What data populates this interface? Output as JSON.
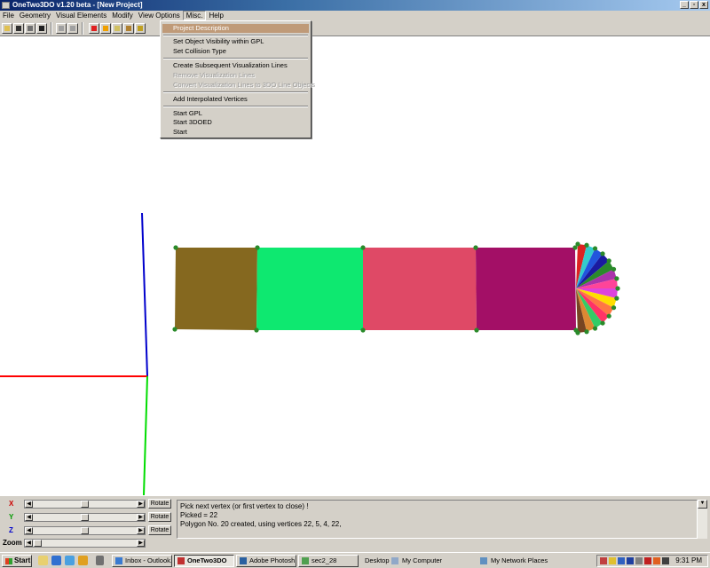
{
  "window": {
    "title": "OneTwo3DO v1.20 beta - [New Project]",
    "controls": {
      "minimize": "_",
      "restore": "▫",
      "close": "x"
    }
  },
  "menubar": [
    "File",
    "Geometry",
    "Visual Elements",
    "Modify",
    "View Options",
    "Misc.",
    "Help"
  ],
  "misc_menu": {
    "groups": [
      [
        {
          "label": "Project Description",
          "enabled": true,
          "highlighted": true
        }
      ],
      [
        {
          "label": "Set Object Visibility within GPL",
          "enabled": true
        },
        {
          "label": "Set Collision Type",
          "enabled": true
        }
      ],
      [
        {
          "label": "Create Subsequent Visualization Lines",
          "enabled": true
        },
        {
          "label": "Remove Visualization Lines",
          "enabled": false
        },
        {
          "label": "Convert Visualization Lines to 3DO Line Objects",
          "enabled": false
        }
      ],
      [
        {
          "label": "Add Interpolated Vertices",
          "enabled": true
        }
      ],
      [
        {
          "label": "Start GPL",
          "enabled": true
        },
        {
          "label": "Start 3DOED",
          "enabled": true
        },
        {
          "label": "Start",
          "enabled": true
        }
      ]
    ]
  },
  "toolbar": {
    "icons": [
      "open-icon",
      "save-icon",
      "copy-icon",
      "disk-icon",
      "undo-icon",
      "redo-icon",
      "vertex-icon",
      "line-icon",
      "polygon-icon",
      "object-icon",
      "texture-icon"
    ]
  },
  "viewport": {
    "axis_colors": {
      "x": "#ff0000",
      "y": "#00dd00",
      "z": "#0000cc"
    },
    "vertex_color": "#2a8a2a",
    "rect_colors": [
      "#85681f",
      "#0ee870",
      "#df4966",
      "#a30f66"
    ],
    "fan_colors": [
      "#dd2222",
      "#33cccc",
      "#2255dd",
      "#1a1aa0",
      "#2a8a2a",
      "#aa33aa",
      "#ff4499",
      "#dd44dd",
      "#ffdd00",
      "#ff7744",
      "#ff3366",
      "#33cc66",
      "#dd8833",
      "#774422"
    ]
  },
  "controls": {
    "sliders": [
      {
        "label": "X",
        "button": "Rotate",
        "color": "#cc0000"
      },
      {
        "label": "Y",
        "button": "Rotate",
        "color": "#009900"
      },
      {
        "label": "Z",
        "button": "Rotate",
        "color": "#0000cc"
      },
      {
        "label": "Zoom",
        "button": "",
        "color": "#000000"
      }
    ]
  },
  "console": {
    "lines": [
      "Pick next vertex (or first vertex to close) !",
      "Picked = 22",
      "Polygon No. 20 created, using vertices 22, 5, 4, 22,"
    ]
  },
  "taskbar": {
    "start": "Start",
    "tasks": [
      {
        "label": "Inbox - Outlook...",
        "active": false
      },
      {
        "label": "OneTwo3DO",
        "active": true
      },
      {
        "label": "Adobe Photosh...",
        "active": false
      },
      {
        "label": "sec2_28",
        "active": false
      }
    ],
    "desktop": "Desktop",
    "my_computer": "My Computer",
    "network": "My Network Places",
    "clock": "9:31 PM"
  }
}
